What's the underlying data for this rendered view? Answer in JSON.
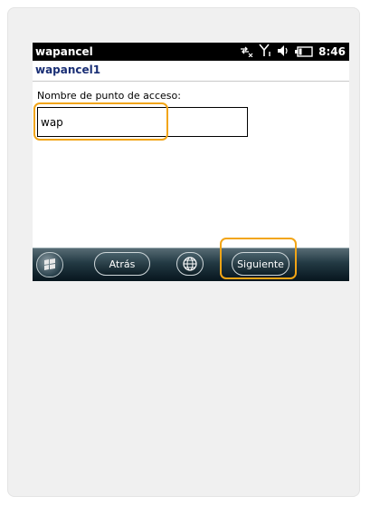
{
  "status_bar": {
    "app_name": "wapancel",
    "time": "8:46",
    "icons": [
      "connectivity-icon",
      "signal-icon",
      "volume-icon",
      "battery-icon"
    ]
  },
  "title_bar": {
    "title": "wapancel1"
  },
  "form": {
    "label": "Nombre de punto de acceso:",
    "value": "wap"
  },
  "soft_keys": {
    "start_icon": "windows-logo-icon",
    "back_label": "Atrás",
    "globe_icon": "globe-icon",
    "next_label": "Siguiente"
  },
  "colors": {
    "highlight": "#f2a516",
    "title_text": "#1a2f75"
  }
}
